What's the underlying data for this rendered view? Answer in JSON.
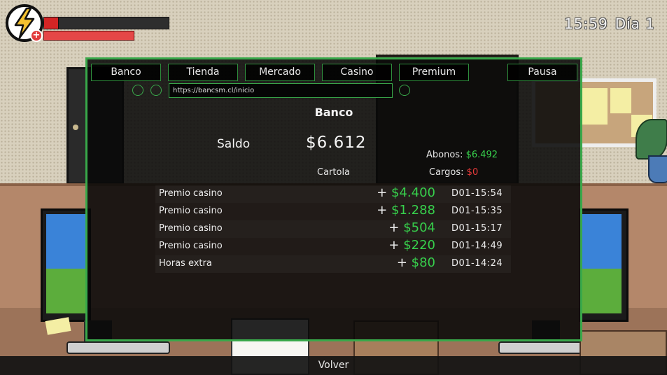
{
  "hud": {
    "energy_icon": "lightning-bolt-icon",
    "health_icon": "red-cross-icon",
    "energy_level": 0.12,
    "health_level": 1.0,
    "time": "15:59",
    "day": "Día 1"
  },
  "nav": {
    "tabs": [
      "Banco",
      "Tienda",
      "Mercado",
      "Casino",
      "Premium"
    ],
    "pause_label": "Pausa",
    "url": "https://bancsm.cl/inicio"
  },
  "bank": {
    "title": "Banco",
    "saldo_label": "Saldo",
    "saldo_value": "$6.612",
    "cartola_label": "Cartola",
    "abonos_label": "Abonos:",
    "abonos_value": "$6.492",
    "cargos_label": "Cargos:",
    "cargos_value": "$0",
    "transactions": [
      {
        "desc": "Premio casino",
        "sign": "+",
        "amount": "$4.400",
        "time": "D01-15:54"
      },
      {
        "desc": "Premio casino",
        "sign": "+",
        "amount": "$1.288",
        "time": "D01-15:35"
      },
      {
        "desc": "Premio casino",
        "sign": "+",
        "amount": "$504",
        "time": "D01-15:17"
      },
      {
        "desc": "Premio casino",
        "sign": "+",
        "amount": "$220",
        "time": "D01-14:49"
      },
      {
        "desc": "Horas extra",
        "sign": "+",
        "amount": "$80",
        "time": "D01-14:24"
      }
    ]
  },
  "footer": {
    "back_label": "Volver"
  },
  "colors": {
    "accent_green": "#39a84a",
    "money_green": "#37d04c",
    "charge_red": "#e63a3a"
  }
}
